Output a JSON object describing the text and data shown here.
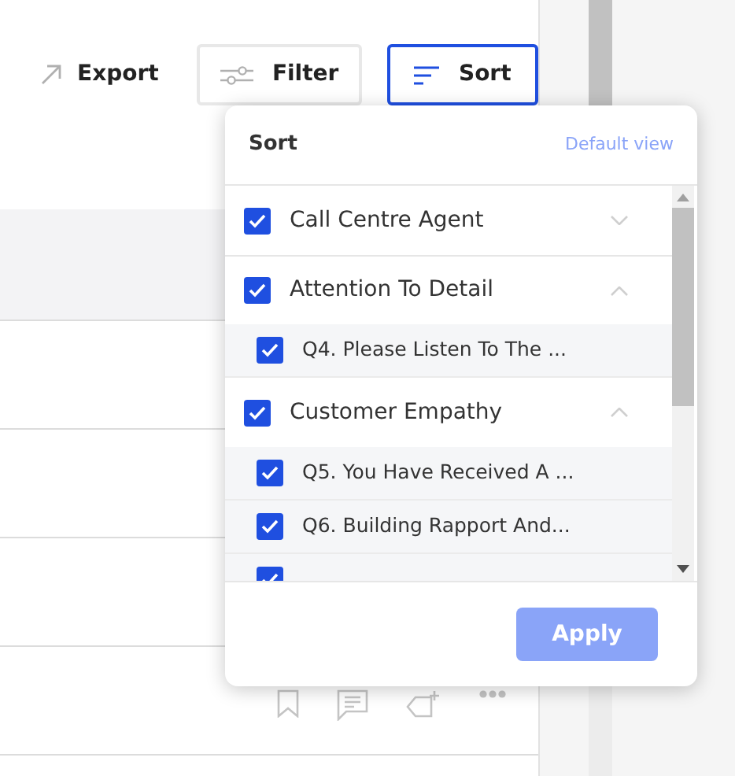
{
  "toolbar": {
    "export": {
      "label": "Export"
    },
    "filter": {
      "label": "Filter",
      "selected": false
    },
    "sort": {
      "label": "Sort",
      "selected": true
    }
  },
  "sort_popover": {
    "title": "Sort",
    "reset_link": "Default view",
    "groups": [
      {
        "label": "Call Centre Agent",
        "checked": true,
        "expanded": false
      },
      {
        "label": "Attention To Detail",
        "checked": true,
        "expanded": true,
        "children": [
          {
            "label": "Q4. Please Listen To The ...",
            "checked": true
          }
        ]
      },
      {
        "label": "Customer Empathy",
        "checked": true,
        "expanded": true,
        "children": [
          {
            "label": "Q5. You Have Received A ...",
            "checked": true
          },
          {
            "label": "Q6. Building Rapport And...",
            "checked": true
          },
          {
            "checked": true
          }
        ]
      }
    ],
    "apply": {
      "label": "Apply",
      "disabled": true
    }
  }
}
